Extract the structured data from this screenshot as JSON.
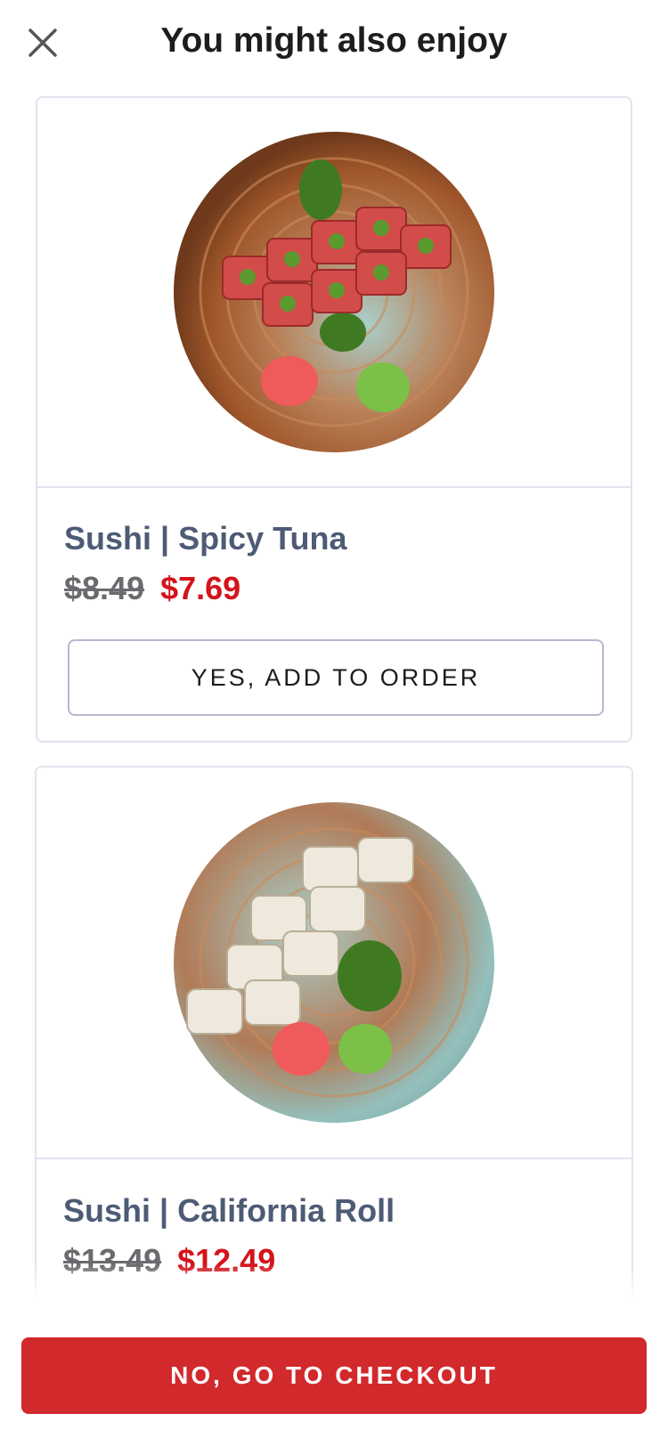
{
  "header": {
    "title": "You might also enjoy",
    "close_icon": "close-icon"
  },
  "items": [
    {
      "name": "Sushi | Spicy Tuna",
      "old_price": "$8.49",
      "new_price": "$7.69",
      "add_label": "YES, ADD TO ORDER"
    },
    {
      "name": "Sushi | California Roll",
      "old_price": "$13.49",
      "new_price": "$12.49"
    }
  ],
  "footer": {
    "checkout_label": "NO, GO TO CHECKOUT"
  },
  "colors": {
    "accent_red": "#d2292c",
    "sale_price": "#d4131b",
    "name_text": "#4e5b75"
  }
}
